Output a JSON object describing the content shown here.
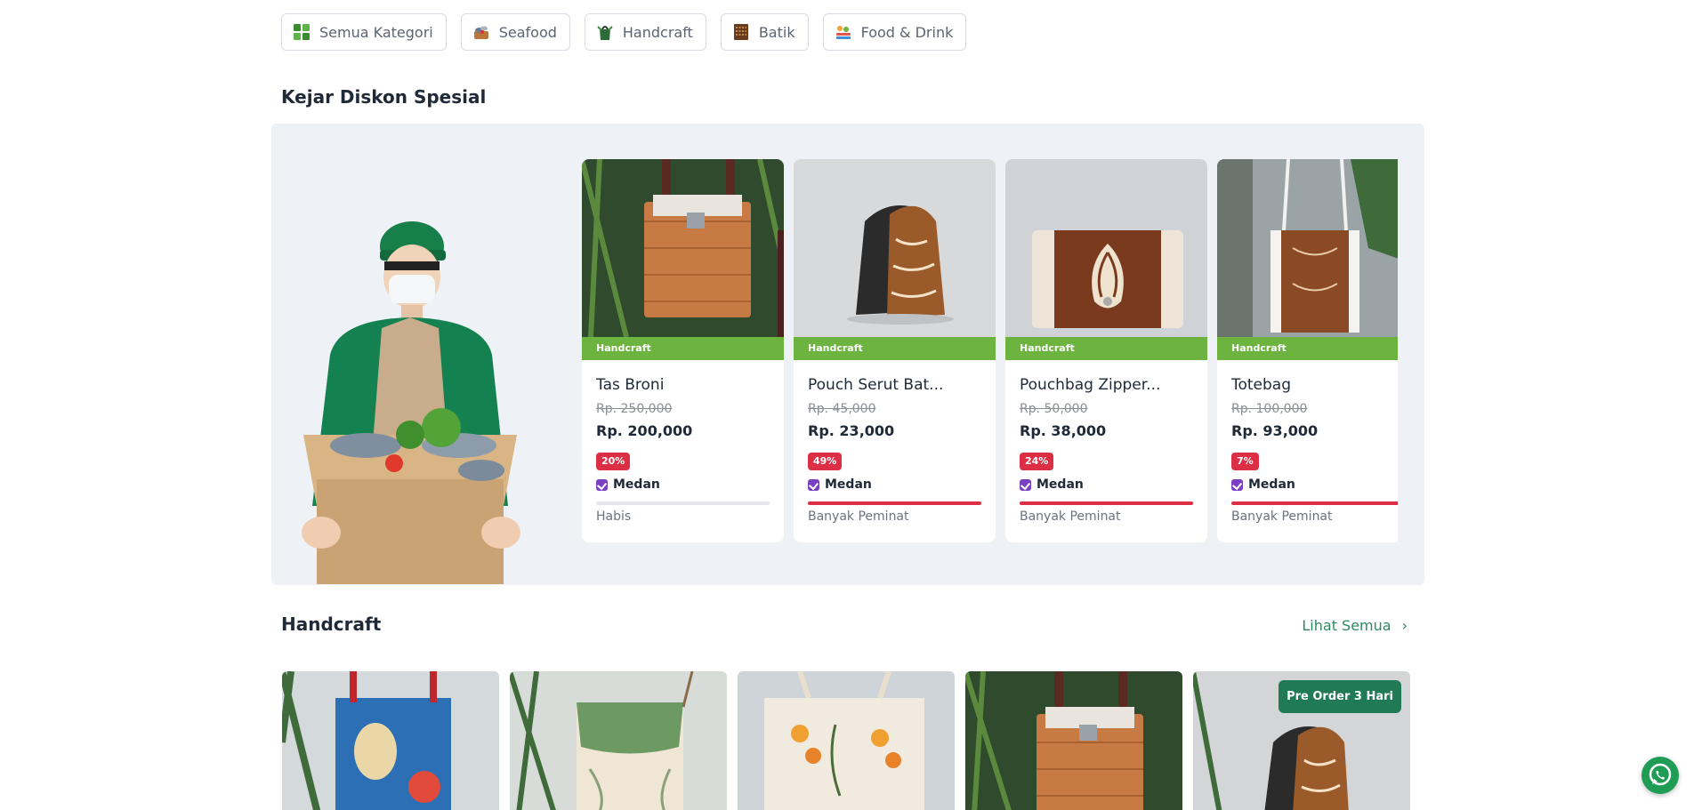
{
  "categories": [
    {
      "label": "Semua Kategori",
      "icon": "grid-icon"
    },
    {
      "label": "Seafood",
      "icon": "seafood-icon"
    },
    {
      "label": "Handcraft",
      "icon": "handcraft-icon"
    },
    {
      "label": "Batik",
      "icon": "batik-icon"
    },
    {
      "label": "Food & Drink",
      "icon": "food-icon"
    }
  ],
  "promo": {
    "title": "Kejar Diskon Spesial",
    "products": [
      {
        "category": "Handcraft",
        "name": "Tas Broni",
        "old_price": "Rp. 250,000",
        "price": "Rp. 200,000",
        "discount": "20%",
        "location": "Medan",
        "status": "Habis",
        "stock_fraction": 0
      },
      {
        "category": "Handcraft",
        "name": "Pouch Serut Bat...",
        "old_price": "Rp. 45,000",
        "price": "Rp. 23,000",
        "discount": "49%",
        "location": "Medan",
        "status": "Banyak Peminat",
        "stock_fraction": 1
      },
      {
        "category": "Handcraft",
        "name": "Pouchbag Zipper...",
        "old_price": "Rp. 50,000",
        "price": "Rp. 38,000",
        "discount": "24%",
        "location": "Medan",
        "status": "Banyak Peminat",
        "stock_fraction": 1
      },
      {
        "category": "Handcraft",
        "name": "Totebag",
        "old_price": "Rp. 100,000",
        "price": "Rp. 93,000",
        "discount": "7%",
        "location": "Medan",
        "status": "Banyak Peminat",
        "stock_fraction": 1
      }
    ]
  },
  "handcraft": {
    "title": "Handcraft",
    "see_all": "Lihat Semua",
    "items": [
      {
        "badge": ""
      },
      {
        "badge": ""
      },
      {
        "badge": ""
      },
      {
        "badge": ""
      },
      {
        "badge": "Pre Order 3 Hari"
      }
    ]
  },
  "colors": {
    "accent_green": "#6db33f",
    "link_green": "#2d8a5f",
    "discount_red": "#dc2f45",
    "whatsapp": "#1f9d55"
  }
}
